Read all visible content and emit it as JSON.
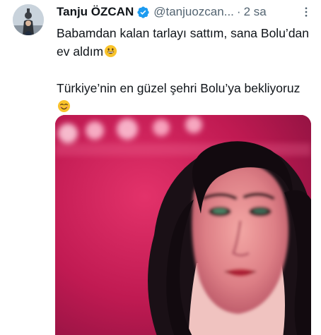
{
  "author": {
    "display_name": "Tanju ÖZCAN",
    "handle": "@tanjuozcan...",
    "separator": "·",
    "time": "2 sa",
    "verified_icon": "verified-badge-icon",
    "avatar": "profile-avatar"
  },
  "tweet": {
    "line1": "Babamdan kalan tarlayı sattım, sana Bolu’dan ev aldım",
    "line2": "Türkiye’nin en güzel şehri Bolu’ya bekliyoruz",
    "emoji1": "grinning-face-emoji",
    "emoji2": "smiling-face-emoji"
  },
  "media": {
    "type": "image",
    "subject": "woman-portrait-photo"
  },
  "icons": {
    "more": "more-options-icon"
  },
  "colors": {
    "text_primary": "#0f1419",
    "text_secondary": "#536471",
    "verified_blue": "#1d9bf0",
    "media_magenta": "#c2184f"
  }
}
